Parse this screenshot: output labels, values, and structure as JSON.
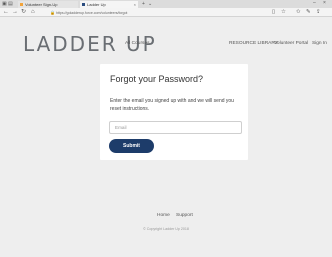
{
  "browser": {
    "tabs": [
      {
        "title": "Volunteer Sign-Up"
      },
      {
        "title": "Ladder Up"
      }
    ],
    "url": "https://goladderup.force.com/volunteers/forgot",
    "window_controls": {
      "minimize": "–",
      "close": "×"
    }
  },
  "site": {
    "logo": "LADDER UP",
    "nav": {
      "all_courses": "All Courses",
      "resource_library": "RESOURCE LIBRARY",
      "volunteer_portal": "Volunteer Portal",
      "sign_in": "Sign In"
    }
  },
  "form": {
    "title": "Forgot your Password?",
    "instructions": "Enter the email you signed up with and we will send you reset instructions.",
    "email_placeholder": "Email",
    "submit_label": "Submit"
  },
  "footer": {
    "home": "Home",
    "support": "Support",
    "copyright": "© Copyright Ladder Up 2018"
  },
  "colors": {
    "page_bg": "#eeeeee",
    "card_bg": "#ffffff",
    "button_bg": "#1d3c6a",
    "logo_color": "#6a6e73"
  }
}
